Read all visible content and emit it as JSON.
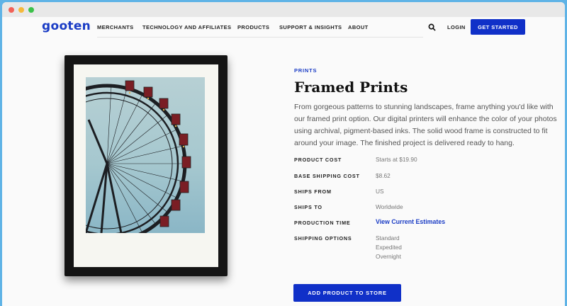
{
  "brand": {
    "logo": "gooten",
    "accent": "#1030c8"
  },
  "nav": {
    "items": [
      "MERCHANTS",
      "TECHNOLOGY AND AFFILIATES",
      "PRODUCTS",
      "SUPPORT & INSIGHTS",
      "ABOUT"
    ],
    "search_icon": "search-icon",
    "login": "LOGIN",
    "cta": "GET STARTED"
  },
  "product": {
    "category": "PRINTS",
    "title": "Framed Prints",
    "description": "From gorgeous patterns to stunning landscapes, frame anything you'd like with our framed print option. Our digital printers will enhance the color of your photos using archival, pigment-based inks. The solid wood frame is constructed to fit around your image. The finished project is delivered ready to hang.",
    "specs": {
      "product_cost": {
        "label": "PRODUCT COST",
        "value": "Starts at $19.90"
      },
      "base_shipping": {
        "label": "BASE SHIPPING COST",
        "value": "$8.62"
      },
      "ships_from": {
        "label": "SHIPS FROM",
        "value": "US"
      },
      "ships_to": {
        "label": "SHIPS TO",
        "value": "Worldwide"
      },
      "production_time": {
        "label": "PRODUCTION TIME",
        "value": "View Current Estimates"
      },
      "shipping_options": {
        "label": "SHIPPING OPTIONS",
        "values": [
          "Standard",
          "Expedited",
          "Overnight"
        ]
      }
    },
    "add_button": "ADD PRODUCT TO STORE"
  }
}
